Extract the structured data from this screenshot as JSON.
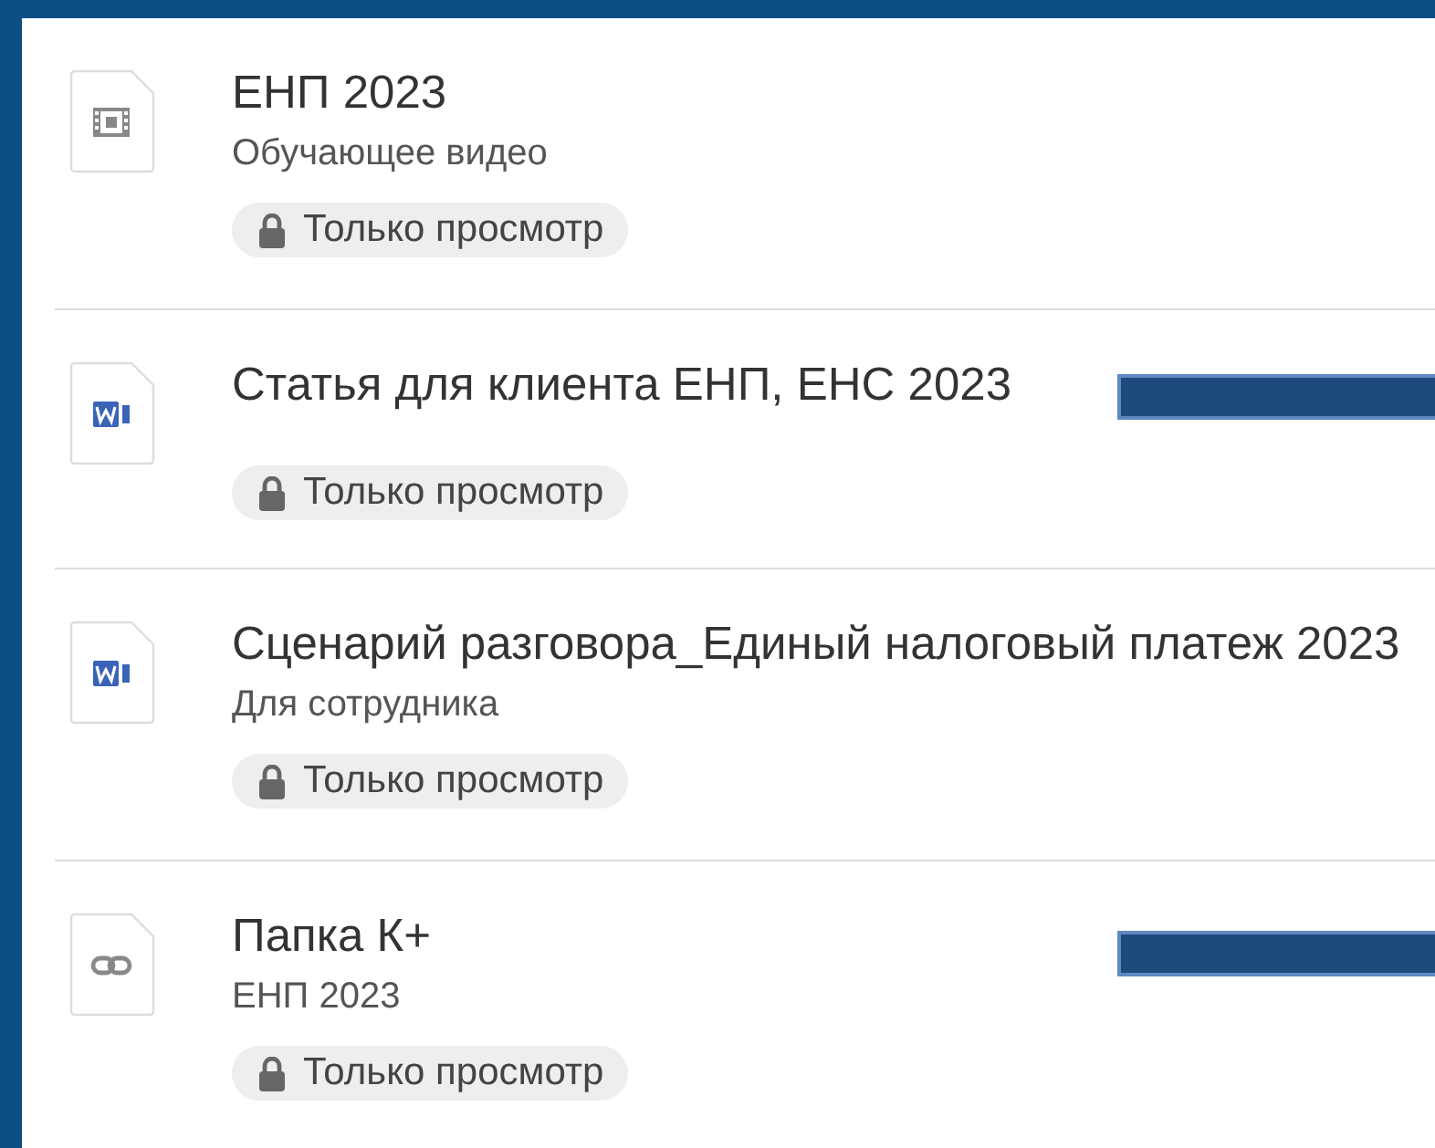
{
  "items": [
    {
      "kind": "video",
      "title": "ЕНП 2023",
      "subtitle": "Обучающее видео",
      "access": "Только просмотр",
      "bar": false
    },
    {
      "kind": "word",
      "title": "Статья для клиента ЕНП, ЕНС 2023",
      "access": "Только просмотр",
      "bar": true
    },
    {
      "kind": "word",
      "title": "Сценарий разговора_Единый налоговый платеж 2023",
      "subtitle": "Для сотрудника",
      "access": "Только просмотр",
      "bar": false
    },
    {
      "kind": "link",
      "title": "Папка К+",
      "subtitle": "ЕНП 2023",
      "access": "Только просмотр",
      "bar": true
    }
  ]
}
